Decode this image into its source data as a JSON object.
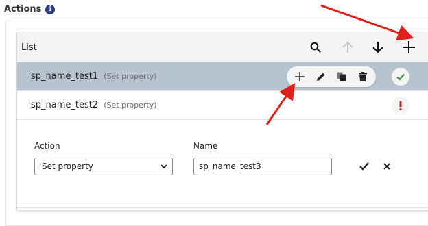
{
  "section": {
    "title": "Actions",
    "info_icon": "i"
  },
  "list": {
    "title": "List",
    "header_icons": [
      "search-icon",
      "arrow-up-icon",
      "arrow-down-icon",
      "plus-icon"
    ],
    "rows": [
      {
        "name": "sp_name_test1",
        "type": "(Set property)",
        "status": "ok",
        "selected": true
      },
      {
        "name": "sp_name_test2",
        "type": "(Set property)",
        "status": "error",
        "selected": false
      }
    ],
    "row_action_icons": [
      "plus-icon",
      "pencil-icon",
      "copy-icon",
      "trash-icon"
    ]
  },
  "form": {
    "action_label": "Action",
    "action_value": "Set property",
    "name_label": "Name",
    "name_value": "sp_name_test3"
  },
  "colors": {
    "selected_row": "#b7c4cf",
    "ok_green": "#3a8b3a",
    "error_red": "#cc1f1f",
    "arrow_red": "#e0201b",
    "info_blue": "#2b3b8f"
  }
}
